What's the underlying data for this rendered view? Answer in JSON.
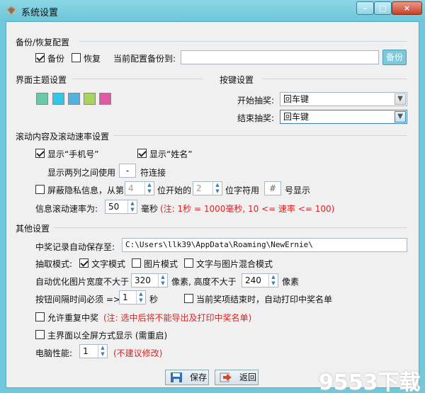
{
  "window": {
    "title": "系统设置",
    "min_glyph": "–",
    "max_glyph": "□",
    "close_glyph": "×"
  },
  "backup": {
    "section_title": "备份/恢复配置",
    "backup_label": "备份",
    "backup_checked": true,
    "restore_label": "恢复",
    "restore_checked": false,
    "path_label": "当前配置备份到:",
    "path_value": "",
    "backup_button": "备份"
  },
  "theme": {
    "section_title": "界面主题设置",
    "swatches": [
      "#6cc9a8",
      "#33c6ea",
      "#54b0e0",
      "#a8d45a",
      "#e05aa0"
    ]
  },
  "keys": {
    "section_title": "按键设置",
    "start_label": "开始抽奖:",
    "start_value": "回车键",
    "end_label": "结束抽奖:",
    "end_value": "回车键"
  },
  "scroll": {
    "section_title": "滚动内容及滚动速率设置",
    "show_phone": "显示“手机号”",
    "show_phone_checked": true,
    "show_name": "显示“姓名”",
    "show_name_checked": true,
    "join_label_prefix": "显示两列之间使用",
    "join_char": "-",
    "join_label_suffix": "符连接",
    "mask_label": "屏蔽隐私信息，从第",
    "mask_checked": false,
    "mask_from": "4",
    "mask_mid": "位开始的",
    "mask_count": "2",
    "mask_mid2": "位字符用",
    "mask_char": "#",
    "mask_suffix": "号显示",
    "speed_label": "信息滚动速率为:",
    "speed_value": "50",
    "speed_unit": "毫秒",
    "speed_note": "(注: 1秒 = 1000毫秒, 10 <= 速率 <= 100)"
  },
  "other": {
    "section_title": "其他设置",
    "autosave_label": "中奖记录自动保存至:",
    "autosave_path": "C:\\Users\\llk39\\AppData\\Roaming\\NewErnie\\",
    "mode_label": "抽取模式:",
    "mode_text": "文字模式",
    "mode_text_checked": true,
    "mode_image": "图片模式",
    "mode_image_checked": false,
    "mode_mixed": "文字与图片混合模式",
    "mode_mixed_checked": false,
    "img_label": "自动优化图片宽度不大于",
    "img_width": "320",
    "img_mid": "像素, 高度不大于",
    "img_height": "240",
    "img_unit": "像素",
    "interval_label": "按钮间隔时间必须 =>",
    "interval_value": "1",
    "interval_unit": "秒",
    "autoprint_label": "当前奖项结束时，自动打印中奖名单",
    "autoprint_checked": false,
    "repeat_label": "允许重复中奖",
    "repeat_checked": false,
    "repeat_note": "(注: 选中后将不能导出及打印中奖名单)",
    "fullscreen_label": "主界面以全屏方式显示 (需重启)",
    "fullscreen_checked": false,
    "perf_label": "电脑性能:",
    "perf_value": "1",
    "perf_note": "(不建议修改)"
  },
  "footer": {
    "save": "保存",
    "back": "返回",
    "watermark": "9553下载"
  }
}
